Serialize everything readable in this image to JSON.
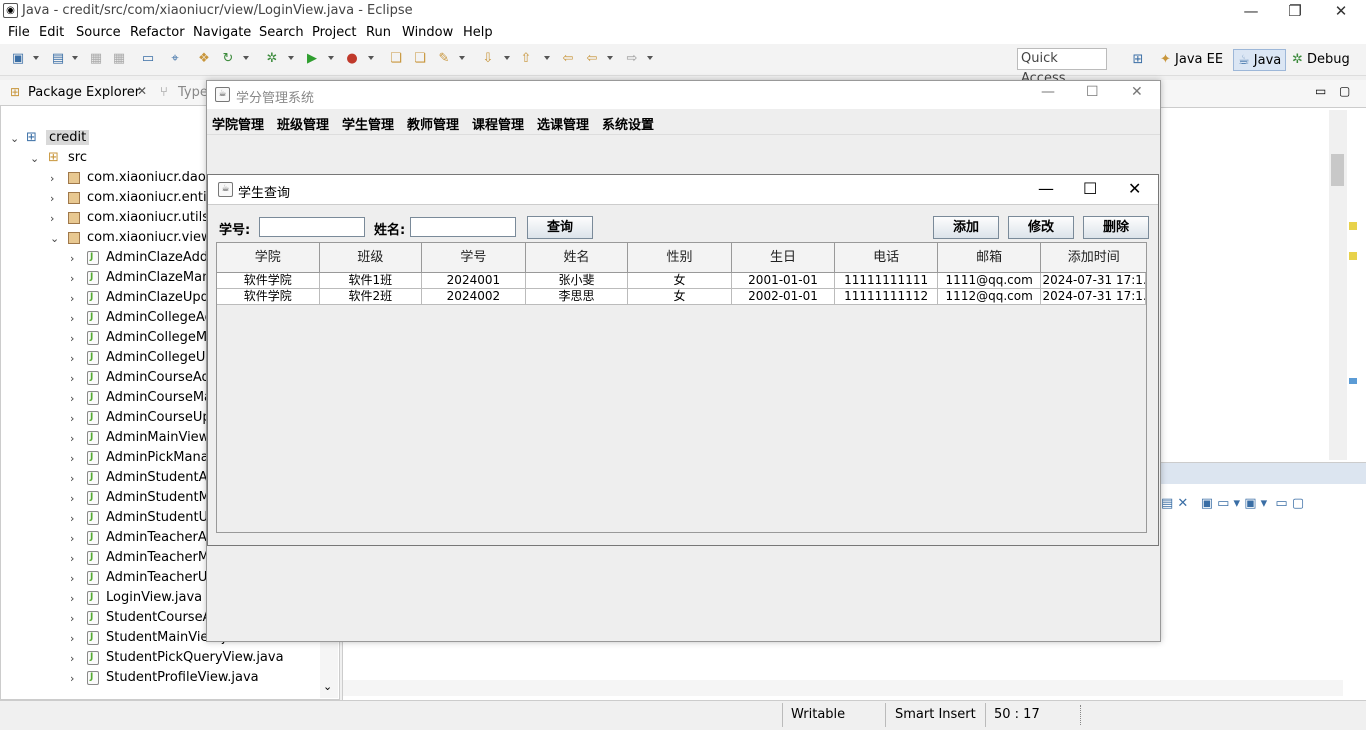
{
  "window": {
    "title": "Java - credit/src/com/xiaoniucr/view/LoginView.java - Eclipse"
  },
  "menu": [
    "File",
    "Edit",
    "Source",
    "Refactor",
    "Navigate",
    "Search",
    "Project",
    "Run",
    "Window",
    "Help"
  ],
  "quick_access": "Quick Access",
  "perspectives": [
    "Java EE",
    "Java",
    "Debug"
  ],
  "package_explorer": {
    "tab": "Package Explorer",
    "tab2": "Type",
    "project": "credit",
    "src": "src",
    "packages": [
      "com.xiaoniucr.dao",
      "com.xiaoniucr.entity",
      "com.xiaoniucr.utils",
      "com.xiaoniucr.view"
    ],
    "files": [
      "AdminClazeAddV",
      "AdminClazeMana",
      "AdminClazeUpda",
      "AdminCollegeAdc",
      "AdminCollegeMa",
      "AdminCollegeUpc",
      "AdminCourseAdd",
      "AdminCourseMar",
      "AdminCourseUpc",
      "AdminMainView.j",
      "AdminPickManag",
      "AdminStudentAdc",
      "AdminStudentMa",
      "AdminStudentUpc",
      "AdminTeacherAd",
      "AdminTeacherMa",
      "AdminTeacherUp",
      "LoginView.java",
      "StudentCourseAll",
      "StudentMainView.java",
      "StudentPickQueryView.java",
      "StudentProfileView.java"
    ]
  },
  "status": {
    "writable": "Writable",
    "insert": "Smart Insert",
    "position": "50 : 17"
  },
  "main_frame": {
    "title": "学分管理系统",
    "menu": [
      "学院管理",
      "班级管理",
      "学生管理",
      "教师管理",
      "课程管理",
      "选课管理",
      "系统设置"
    ]
  },
  "query_frame": {
    "title": "学生查询",
    "student_no_label": "学号:",
    "name_label": "姓名:",
    "student_no_value": "",
    "name_value": "",
    "query_btn": "查询",
    "add_btn": "添加",
    "edit_btn": "修改",
    "delete_btn": "删除",
    "columns": [
      "学院",
      "班级",
      "学号",
      "姓名",
      "性别",
      "生日",
      "电话",
      "邮箱",
      "添加时间"
    ],
    "rows": [
      [
        "软件学院",
        "软件1班",
        "2024001",
        "张小斐",
        "女",
        "2001-01-01",
        "11111111111",
        "1111@qq.com",
        "2024-07-31 17:1..."
      ],
      [
        "软件学院",
        "软件2班",
        "2024002",
        "李思思",
        "女",
        "2002-01-01",
        "11111111112",
        "1112@qq.com",
        "2024-07-31 17:1..."
      ]
    ]
  }
}
